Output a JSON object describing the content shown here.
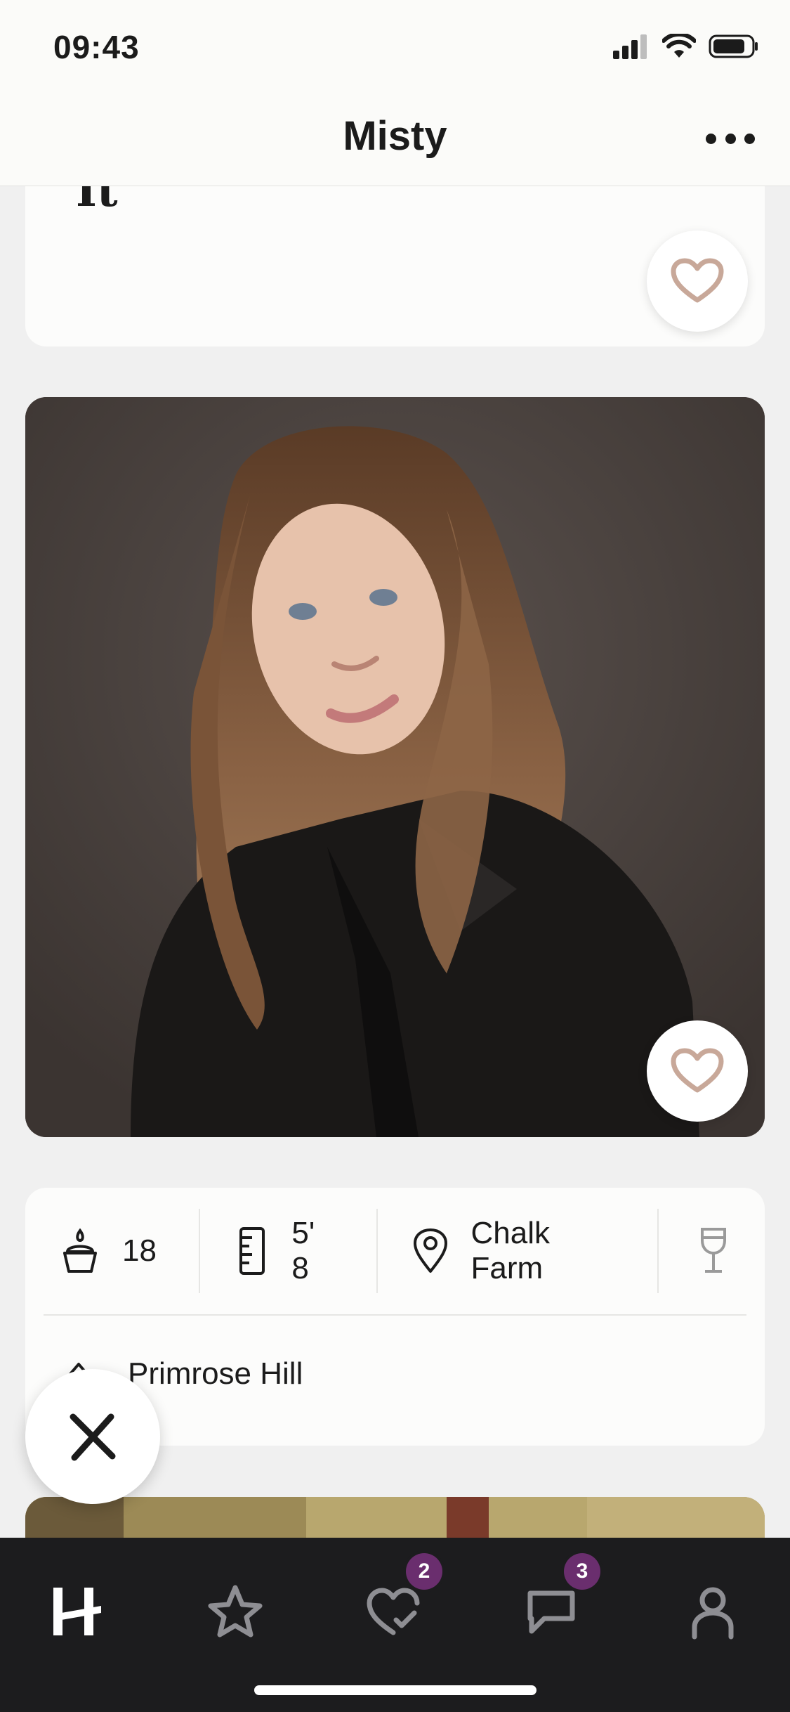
{
  "status_bar": {
    "time": "09:43"
  },
  "header": {
    "title": "Misty"
  },
  "prompt": {
    "answer_text": "It"
  },
  "vitals": [
    {
      "icon": "cake-icon",
      "value": "18"
    },
    {
      "icon": "ruler-icon",
      "value": "5' 8"
    },
    {
      "icon": "location-pin-icon",
      "value": "Chalk Farm"
    },
    {
      "icon": "wine-glass-icon",
      "value": ""
    }
  ],
  "hometown": {
    "icon": "home-icon",
    "value": "Primrose Hill"
  },
  "tabbar": {
    "tabs": [
      {
        "name": "home",
        "icon": "hinge-logo-icon",
        "badge": ""
      },
      {
        "name": "standouts",
        "icon": "star-icon",
        "badge": ""
      },
      {
        "name": "likes",
        "icon": "heart-check-icon",
        "badge": "2"
      },
      {
        "name": "matches",
        "icon": "chat-icon",
        "badge": "3"
      },
      {
        "name": "profile",
        "icon": "person-icon",
        "badge": ""
      }
    ]
  },
  "colors": {
    "accent": "#6a2e6e",
    "heart": "#c8a899",
    "tabbar_bg": "#1c1c1e",
    "background": "#f0f0f0"
  }
}
